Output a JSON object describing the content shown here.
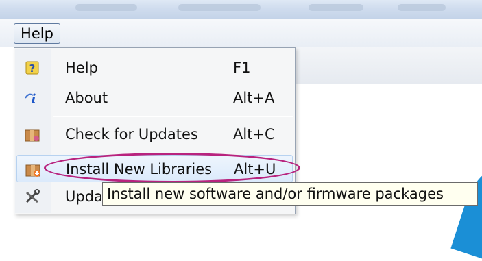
{
  "menubar": {
    "help_label": "Help"
  },
  "menu": {
    "items": [
      {
        "label": "Help",
        "shortcut": "F1",
        "icon": "help-icon"
      },
      {
        "label": "About",
        "shortcut": "Alt+A",
        "icon": "about-icon"
      },
      {
        "label": "Check for Updates",
        "shortcut": "Alt+C",
        "icon": "package-update-icon"
      },
      {
        "label": "Install New Libraries",
        "shortcut": "Alt+U",
        "icon": "package-install-icon"
      },
      {
        "label": "Upda",
        "shortcut": "",
        "icon": "tools-icon"
      }
    ]
  },
  "tooltip": {
    "text": "Install new software and/or firmware packages"
  },
  "colors": {
    "highlight_ellipse": "#b8237e",
    "tooltip_bg": "#fffff0",
    "menu_bg": "#f5f6f7",
    "hover_bg": "#dbeafb"
  }
}
